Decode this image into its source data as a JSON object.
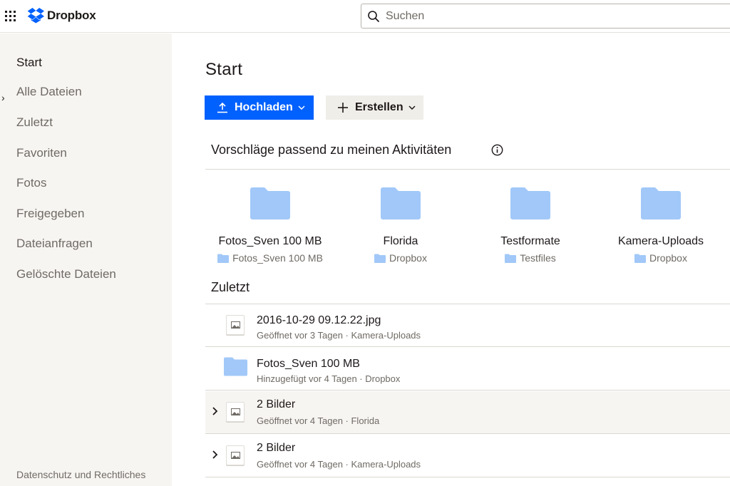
{
  "header": {
    "brand": "Dropbox",
    "search_placeholder": "Suchen"
  },
  "sidebar": {
    "items": [
      {
        "label": "Start"
      },
      {
        "label": "Alle Dateien"
      },
      {
        "label": "Zuletzt"
      },
      {
        "label": "Favoriten"
      },
      {
        "label": "Fotos"
      },
      {
        "label": "Freigegeben"
      },
      {
        "label": "Dateianfragen"
      },
      {
        "label": "Gelöschte Dateien"
      }
    ],
    "footer_link": "Datenschutz und Rechtliches"
  },
  "main": {
    "title": "Start",
    "upload_label": "Hochladen",
    "create_label": "Erstellen",
    "suggestions_title": "Vorschläge passend zu meinen Aktivitäten",
    "suggestions": [
      {
        "name": "Fotos_Sven 100 MB",
        "location": "Fotos_Sven 100 MB"
      },
      {
        "name": "Florida",
        "location": "Dropbox"
      },
      {
        "name": "Testformate",
        "location": "Testfiles"
      },
      {
        "name": "Kamera-Uploads",
        "location": "Dropbox"
      }
    ],
    "recent_title": "Zuletzt",
    "recent": [
      {
        "name": "2016-10-29 09.12.22.jpg",
        "meta": "Geöffnet vor 3 Tagen · Kamera-Uploads",
        "icon": "image-file-icon"
      },
      {
        "name": "Fotos_Sven 100 MB",
        "meta": "Hinzugefügt vor 4 Tagen · Dropbox",
        "icon": "folder-icon"
      },
      {
        "name": "2 Bilder",
        "meta": "Geöffnet vor 4 Tagen · Florida",
        "icon": "image-file-icon"
      },
      {
        "name": "2 Bilder",
        "meta": "Geöffnet vor 4 Tagen · Kamera-Uploads",
        "icon": "image-file-icon"
      }
    ]
  },
  "colors": {
    "accent": "#0061fe",
    "folder": "#a1c8f8",
    "sidebar_bg": "#f7f5f2"
  }
}
